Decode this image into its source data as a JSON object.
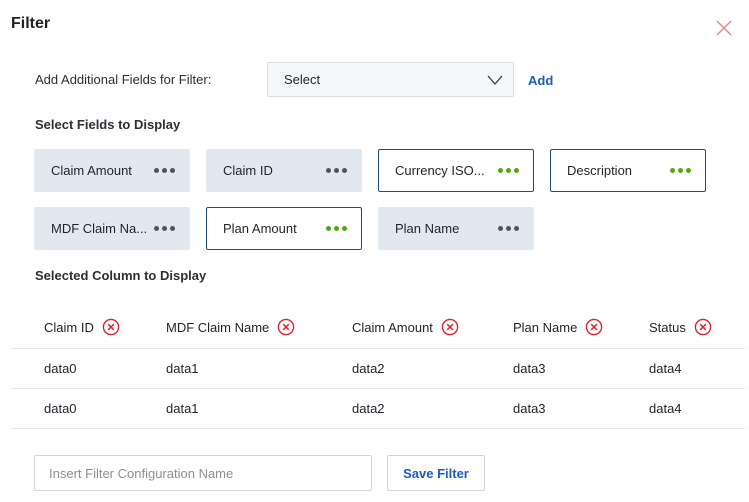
{
  "dialog": {
    "title": "Filter",
    "add_fields_label": "Add Additional Fields for Filter:",
    "select_value": "Select",
    "add_label": "Add",
    "select_fields_label": "Select Fields to Display",
    "selected_columns_label": "Selected Column to Display"
  },
  "field_chips": [
    {
      "label": "Claim Amount",
      "selected": false
    },
    {
      "label": "Claim ID",
      "selected": false
    },
    {
      "label": "Currency ISO...",
      "selected": true
    },
    {
      "label": "Description",
      "selected": true
    },
    {
      "label": "MDF Claim Na...",
      "selected": false
    },
    {
      "label": "Plan Amount",
      "selected": true
    },
    {
      "label": "Plan Name",
      "selected": false
    }
  ],
  "table": {
    "columns": [
      "Claim ID",
      "MDF Claim Name",
      "Claim Amount",
      "Plan Name",
      "Status"
    ],
    "rows": [
      [
        "data0",
        "data1",
        "data2",
        "data3",
        "data4"
      ],
      [
        "data0",
        "data1",
        "data2",
        "data3",
        "data4"
      ]
    ]
  },
  "footer": {
    "name_placeholder": "Insert Filter Configuration Name",
    "name_value": "",
    "save_label": "Save Filter"
  },
  "colors": {
    "accent_blue": "#1d5bbf",
    "selected_dots": "#56a413",
    "remove_red": "#e0242f",
    "chip_bg": "#e2e8f0"
  },
  "icons": {
    "close": "close-icon",
    "dropdown": "chevron-down-icon",
    "remove": "remove-circle-icon",
    "more": "more-dots-icon"
  }
}
